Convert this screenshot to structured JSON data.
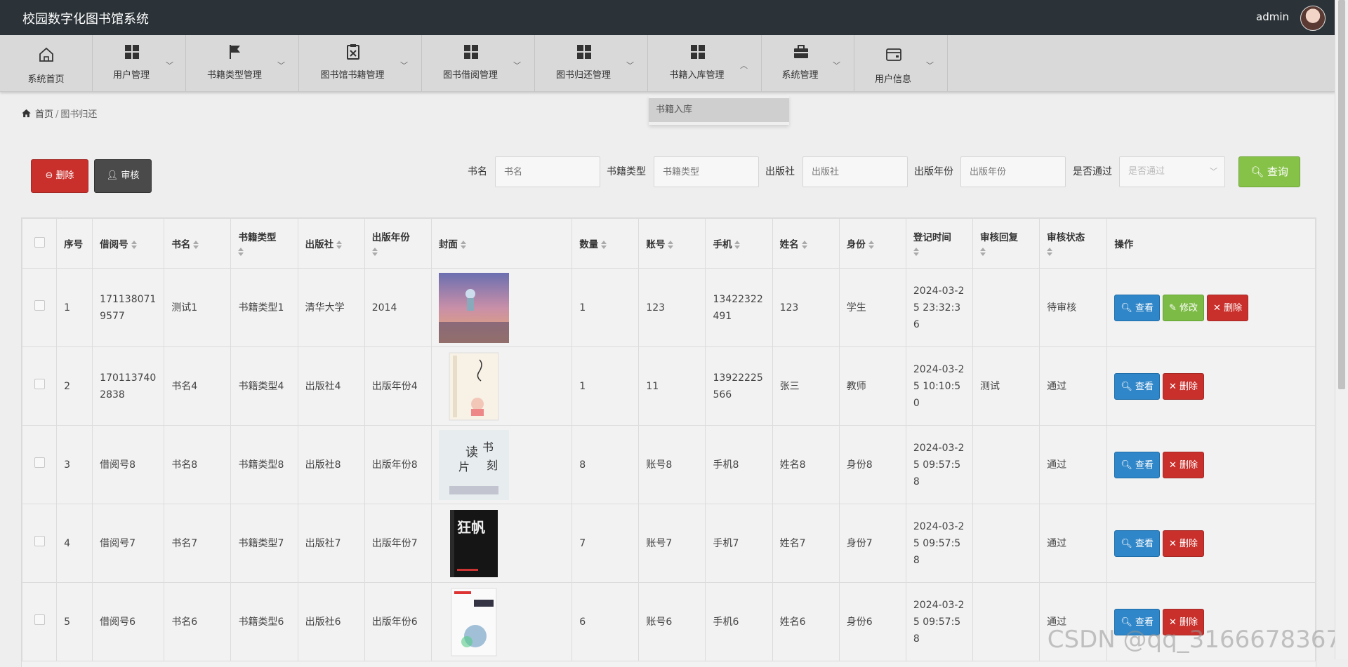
{
  "app": {
    "title": "校园数字化图书馆系统",
    "user": "admin"
  },
  "nav": {
    "items": [
      {
        "label": "系统首页",
        "icon": "home-icon"
      },
      {
        "label": "用户管理",
        "icon": "grid-icon"
      },
      {
        "label": "书籍类型管理",
        "icon": "flag-icon"
      },
      {
        "label": "图书馆书籍管理",
        "icon": "clipboard-x-icon"
      },
      {
        "label": "图书借阅管理",
        "icon": "grid-icon"
      },
      {
        "label": "图书归还管理",
        "icon": "grid-icon"
      },
      {
        "label": "书籍入库管理",
        "icon": "grid-icon"
      },
      {
        "label": "系统管理",
        "icon": "briefcase-icon"
      },
      {
        "label": "用户信息",
        "icon": "card-icon"
      }
    ],
    "dropdown_item": "书籍入库"
  },
  "breadcrumb": {
    "home": "首页",
    "current": "图书归还"
  },
  "toolbar": {
    "delete_label": "删除",
    "audit_label": "审核",
    "query_label": "查询"
  },
  "filters": [
    {
      "label": "书名",
      "placeholder": "书名"
    },
    {
      "label": "书籍类型",
      "placeholder": "书籍类型"
    },
    {
      "label": "出版社",
      "placeholder": "出版社"
    },
    {
      "label": "出版年份",
      "placeholder": "出版年份"
    },
    {
      "label": "是否通过",
      "placeholder": "是否通过"
    }
  ],
  "table": {
    "headers": [
      "序号",
      "借阅号",
      "书名",
      "书籍类型",
      "出版社",
      "出版年份",
      "封面",
      "数量",
      "账号",
      "手机",
      "姓名",
      "身份",
      "登记时间",
      "审核回复",
      "审核状态",
      "操作"
    ],
    "rows": [
      {
        "no": "1",
        "borrow_no": "1711380719577",
        "name": "测试1",
        "type": "书籍类型1",
        "publisher": "清华大学",
        "year": "2014",
        "qty": "1",
        "account": "123",
        "phone": "13422322491",
        "person": "123",
        "role": "学生",
        "time": "2024-03-25 23:32:36",
        "reply": "",
        "status": "待审核",
        "cover": "cover-anime"
      },
      {
        "no": "2",
        "borrow_no": "1701137402838",
        "name": "书名4",
        "type": "书籍类型4",
        "publisher": "出版社4",
        "year": "出版年份4",
        "qty": "1",
        "account": "11",
        "phone": "13922225566",
        "person": "张三",
        "role": "教师",
        "time": "2024-03-25 10:10:50",
        "reply": "测试",
        "status": "通过",
        "cover": "cover-light"
      },
      {
        "no": "3",
        "borrow_no": "借阅号8",
        "name": "书名8",
        "type": "书籍类型8",
        "publisher": "出版社8",
        "year": "出版年份8",
        "qty": "8",
        "account": "账号8",
        "phone": "手机8",
        "person": "姓名8",
        "role": "身份8",
        "time": "2024-03-25 09:57:58",
        "reply": "",
        "status": "通过",
        "cover": "cover-read"
      },
      {
        "no": "4",
        "borrow_no": "借阅号7",
        "name": "书名7",
        "type": "书籍类型7",
        "publisher": "出版社7",
        "year": "出版年份7",
        "qty": "7",
        "account": "账号7",
        "phone": "手机7",
        "person": "姓名7",
        "role": "身份7",
        "time": "2024-03-25 09:57:58",
        "reply": "",
        "status": "通过",
        "cover": "cover-dark"
      },
      {
        "no": "5",
        "borrow_no": "借阅号6",
        "name": "书名6",
        "type": "书籍类型6",
        "publisher": "出版社6",
        "year": "出版年份6",
        "qty": "6",
        "account": "账号6",
        "phone": "手机6",
        "person": "姓名6",
        "role": "身份6",
        "time": "2024-03-25 09:57:58",
        "reply": "",
        "status": "通过",
        "cover": "cover-white"
      }
    ],
    "actions": {
      "view": "查看",
      "edit": "修改",
      "delete": "删除"
    }
  },
  "watermark": "CSDN @qq_3166678367",
  "colors": {
    "topbar": "#2b3338",
    "danger": "#c9302c",
    "primary": "#2f86c8",
    "success": "#7cbb45",
    "dark": "#4a4a4a"
  }
}
